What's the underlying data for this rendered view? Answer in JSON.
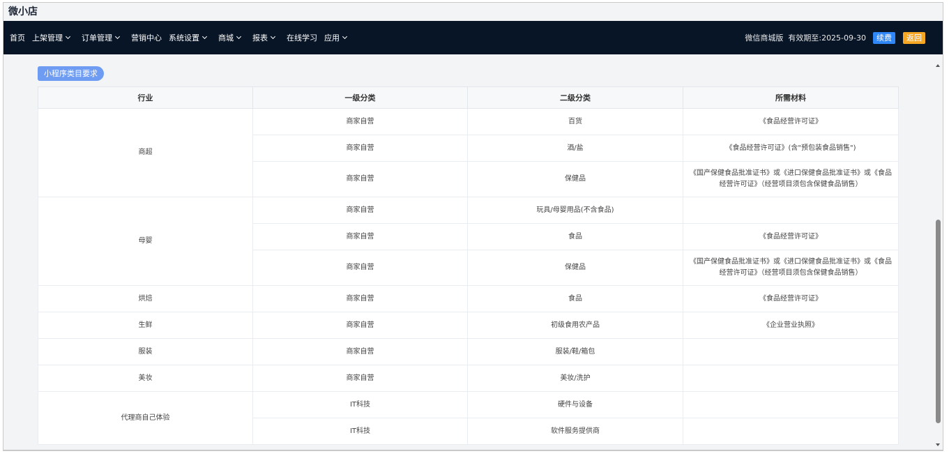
{
  "app": {
    "title": "微小店"
  },
  "nav": {
    "items": [
      {
        "label": "首页",
        "dropdown": false
      },
      {
        "label": "上架管理",
        "dropdown": true
      },
      {
        "label": "订单管理",
        "dropdown": true
      },
      {
        "label": "营销中心",
        "dropdown": false
      },
      {
        "label": "系统设置",
        "dropdown": true
      },
      {
        "label": "商城",
        "dropdown": true
      },
      {
        "label": "报表",
        "dropdown": true
      },
      {
        "label": "在线学习",
        "dropdown": false
      },
      {
        "label": "应用",
        "dropdown": true
      }
    ],
    "edition": "微信商城版",
    "expiry": "有效期至:2025-09-30",
    "renew_label": "续费",
    "back_label": "返回"
  },
  "section": {
    "pill_label": "小程序类目要求"
  },
  "table": {
    "headers": [
      "行业",
      "一级分类",
      "二级分类",
      "所需材料"
    ],
    "industries": [
      "商超",
      "母婴",
      "烘焙",
      "生鲜",
      "服装",
      "美妆",
      "代理商自己体验"
    ],
    "rows": [
      {
        "primary": "商家自营",
        "secondary": "百货",
        "material": "《食品经营许可证》"
      },
      {
        "primary": "商家自营",
        "secondary": "酒/盐",
        "material": "《食品经营许可证》(含\"预包装食品销售\")"
      },
      {
        "primary": "商家自营",
        "secondary": "保健品",
        "material": "《国产保健食品批准证书》或《进口保健食品批准证书》或《食品经营许可证》（经营项目须包含保健食品销售）"
      },
      {
        "primary": "商家自营",
        "secondary": "玩具/母婴用品(不含食品)",
        "material": ""
      },
      {
        "primary": "商家自营",
        "secondary": "食品",
        "material": "《食品经营许可证》"
      },
      {
        "primary": "商家自营",
        "secondary": "保健品",
        "material": "《国产保健食品批准证书》或《进口保健食品批准证书》或《食品经营许可证》（经营项目须包含保健食品销售）"
      },
      {
        "primary": "商家自营",
        "secondary": "食品",
        "material": "《食品经营许可证》"
      },
      {
        "primary": "商家自营",
        "secondary": "初级食用农产品",
        "material": "《企业营业执照》"
      },
      {
        "primary": "商家自营",
        "secondary": "服装/鞋/箱包",
        "material": ""
      },
      {
        "primary": "商家自营",
        "secondary": "美妆/洗护",
        "material": ""
      },
      {
        "primary": "IT科技",
        "secondary": "硬件与设备",
        "material": ""
      },
      {
        "primary": "IT科技",
        "secondary": "软件服务提供商",
        "material": ""
      }
    ]
  }
}
